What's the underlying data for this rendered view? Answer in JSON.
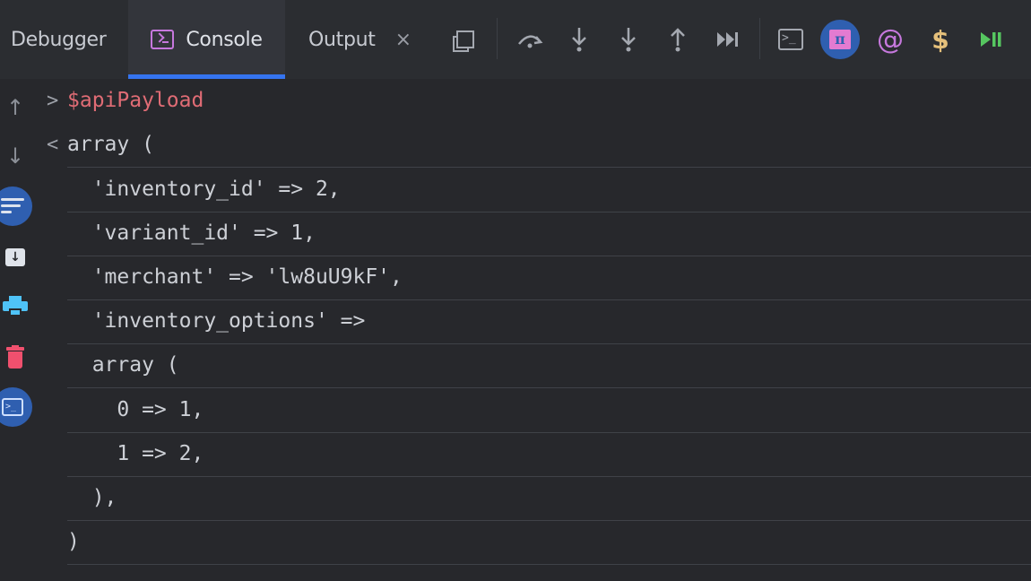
{
  "toolbar": {
    "tabs": [
      {
        "label": "Debugger",
        "active": false
      },
      {
        "label": "Console",
        "active": true
      },
      {
        "label": "Output",
        "active": false
      }
    ],
    "close_glyph": "×",
    "icons": [
      "restore-layout-icon",
      "step-over-icon",
      "step-into-icon",
      "force-step-into-icon",
      "step-out-icon",
      "run-to-cursor-icon",
      "terminal-icon",
      "pi-icon",
      "at-icon",
      "dollar-icon",
      "resume-icon"
    ],
    "pi_glyph": "π",
    "at_glyph": "@",
    "dollar_glyph": "$",
    "term_glyph": ">_",
    "colors": {
      "accent": "#3574f0",
      "pi_bg": "#2f5fb0",
      "purple": "#c678dd",
      "yellow": "#e5c07b",
      "green": "#56c760"
    }
  },
  "sidebar": {
    "icons": [
      "scroll-up-icon",
      "scroll-down-icon",
      "soft-wrap-icon",
      "download-icon",
      "print-icon",
      "trash-icon",
      "console-icon"
    ],
    "up_glyph": "↑",
    "down_glyph": "↓"
  },
  "console": {
    "input_prompt": ">",
    "output_prompt": "<",
    "input": "$apiPayload",
    "output_lines": [
      "array (",
      "  'inventory_id' => 2,",
      "  'variant_id' => 1,",
      "  'merchant' => 'lw8uU9kF',",
      "  'inventory_options' =>",
      "  array (",
      "    0 => 1,",
      "    1 => 2,",
      "  ),",
      ")"
    ]
  }
}
